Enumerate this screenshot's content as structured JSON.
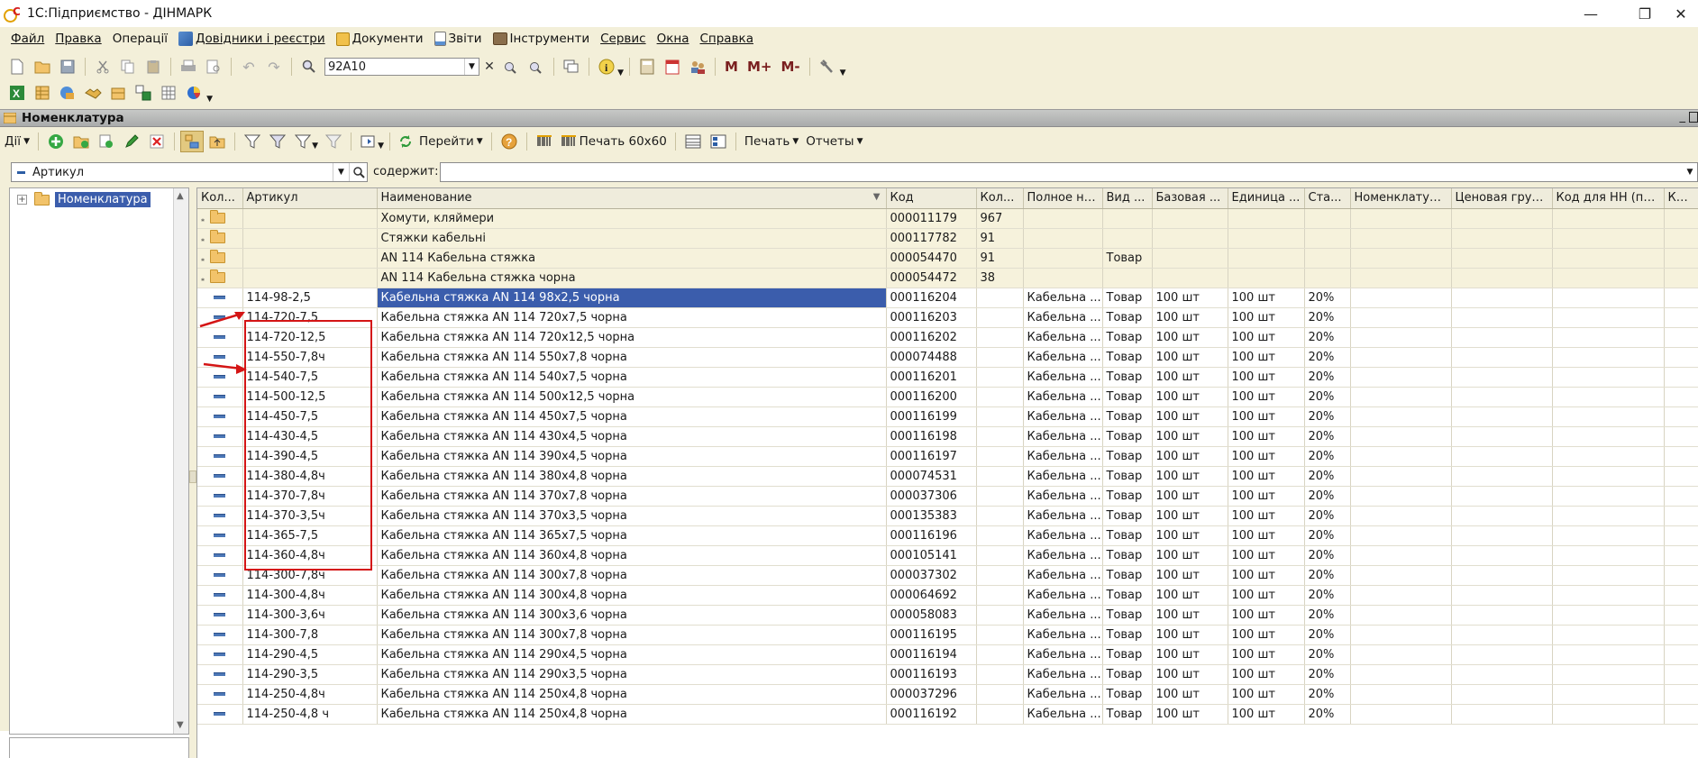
{
  "window": {
    "title": "1С:Підприємство - ДІНМАРК",
    "controls": [
      "—",
      "❐",
      "✕"
    ]
  },
  "menu": [
    {
      "label": "Файл",
      "icon": ""
    },
    {
      "label": "Правка",
      "icon": ""
    },
    {
      "label": "Операції",
      "icon": ""
    },
    {
      "label": "Довідники і реєстри",
      "icon": "directory-icon"
    },
    {
      "label": "Документи",
      "icon": "documents-icon"
    },
    {
      "label": "Звіти",
      "icon": "reports-icon"
    },
    {
      "label": "Інструменти",
      "icon": "tools-icon"
    },
    {
      "label": "Сервис",
      "icon": ""
    },
    {
      "label": "Окна",
      "icon": ""
    },
    {
      "label": "Справка",
      "icon": ""
    }
  ],
  "toolbar": {
    "search_value": "92A10",
    "memory_buttons": [
      "M",
      "M+",
      "M-"
    ]
  },
  "panel": {
    "title": "Номенклатура"
  },
  "actions": {
    "dii": "Дії",
    "goto": "Перейти",
    "print_label": "Печать 60x60",
    "print": "Печать",
    "reports": "Отчеты"
  },
  "filter": {
    "field_value": "Артикул",
    "contains_label": "содержит:",
    "contains_value": ""
  },
  "tree": {
    "root": "Номенклатура"
  },
  "grid": {
    "columns": [
      "Кол...",
      "Артикул",
      "Наименование",
      "Код",
      "Кол...",
      "Полное на...",
      "Вид ...",
      "Базовая ...",
      "Единица ...",
      "Ста...",
      "Номенклатур...",
      "Ценовая груп...",
      "Код для НН (по-...",
      "Коммента"
    ],
    "folders": [
      {
        "name": "Хомути, кляймери",
        "code": "000011179",
        "qty": "967",
        "kind": ""
      },
      {
        "name": "Стяжки кабельні",
        "code": "000117782",
        "qty": "91",
        "kind": ""
      },
      {
        "name": "AN 114 Кабельна стяжка",
        "code": "000054470",
        "qty": "91",
        "kind": "Товар"
      },
      {
        "name": "AN 114 Кабельна стяжка чорна",
        "code": "000054472",
        "qty": "38",
        "kind": ""
      }
    ],
    "items": [
      {
        "art": "114-98-2,5",
        "name": "Кабельна стяжка AN 114 98х2,5 чорна",
        "code": "000116204"
      },
      {
        "art": "114-720-7,5",
        "name": "Кабельна стяжка AN 114 720х7,5 чорна",
        "code": "000116203"
      },
      {
        "art": "114-720-12,5",
        "name": "Кабельна стяжка AN 114 720х12,5 чорна",
        "code": "000116202"
      },
      {
        "art": "114-550-7,8ч",
        "name": "Кабельна стяжка AN 114 550х7,8 чорна",
        "code": "000074488"
      },
      {
        "art": "114-540-7,5",
        "name": "Кабельна стяжка AN 114 540х7,5 чорна",
        "code": "000116201"
      },
      {
        "art": "114-500-12,5",
        "name": "Кабельна стяжка AN 114 500х12,5 чорна",
        "code": "000116200"
      },
      {
        "art": "114-450-7,5",
        "name": "Кабельна стяжка AN 114 450х7,5 чорна",
        "code": "000116199"
      },
      {
        "art": "114-430-4,5",
        "name": "Кабельна стяжка AN 114 430х4,5 чорна",
        "code": "000116198"
      },
      {
        "art": "114-390-4,5",
        "name": "Кабельна стяжка AN 114 390х4,5 чорна",
        "code": "000116197"
      },
      {
        "art": "114-380-4,8ч",
        "name": "Кабельна стяжка AN 114 380х4,8 чорна",
        "code": "000074531"
      },
      {
        "art": "114-370-7,8ч",
        "name": "Кабельна стяжка AN 114 370х7,8 чорна",
        "code": "000037306"
      },
      {
        "art": "114-370-3,5ч",
        "name": "Кабельна стяжка AN 114 370х3,5 чорна",
        "code": "000135383"
      },
      {
        "art": "114-365-7,5",
        "name": "Кабельна стяжка AN 114 365х7,5 чорна",
        "code": "000116196"
      },
      {
        "art": "114-360-4,8ч",
        "name": "Кабельна стяжка AN 114 360х4,8 чорна",
        "code": "000105141"
      },
      {
        "art": "114-300-7,8ч",
        "name": "Кабельна стяжка AN 114 300х7,8 чорна",
        "code": "000037302"
      },
      {
        "art": "114-300-4,8ч",
        "name": "Кабельна стяжка AN 114 300х4,8 чорна",
        "code": "000064692"
      },
      {
        "art": "114-300-3,6ч",
        "name": "Кабельна стяжка AN 114 300х3,6 чорна",
        "code": "000058083"
      },
      {
        "art": "114-300-7,8",
        "name": "Кабельна стяжка AN 114 300х7,8 чорна",
        "code": "000116195"
      },
      {
        "art": "114-290-4,5",
        "name": "Кабельна стяжка AN 114 290х4,5 чорна",
        "code": "000116194"
      },
      {
        "art": "114-290-3,5",
        "name": "Кабельна стяжка AN 114 290х3,5 чорна",
        "code": "000116193"
      },
      {
        "art": "114-250-4,8ч",
        "name": "Кабельна стяжка AN 114 250х4,8 чорна",
        "code": "000037296"
      },
      {
        "art": "114-250-4,8 ч",
        "name": "Кабельна стяжка AN 114 250х4,8 чорна",
        "code": "000116192"
      }
    ],
    "item_full_name": "Кабельна ...",
    "item_kind": "Товар",
    "item_base_unit": "100 шт",
    "item_unit": "100 шт",
    "item_rate": "20%"
  },
  "colors": {
    "background": "#f3efd9",
    "selection": "#3b5dac",
    "highlight_box": "#d41515"
  }
}
